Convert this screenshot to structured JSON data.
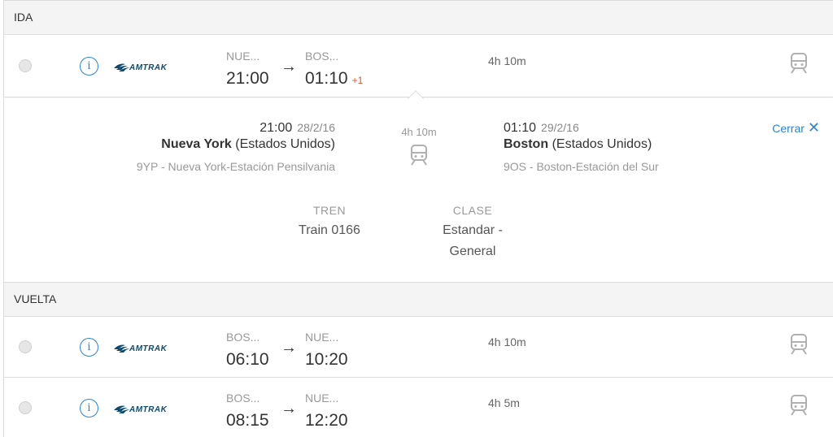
{
  "outbound": {
    "header": "IDA",
    "rows": [
      {
        "operator": "AMTRAK",
        "from_code": "NUE...",
        "to_code": "BOS...",
        "depart": "21:00",
        "arrive": "01:10",
        "day_offset": "+1",
        "duration": "4h 10m"
      }
    ],
    "detail": {
      "close_label": "Cerrar",
      "depart_time": "21:00",
      "depart_date": "28/2/16",
      "depart_city": "Nueva York",
      "depart_country": "(Estados Unidos)",
      "depart_station": "9YP - Nueva York-Estación Pensilvania",
      "duration": "4h 10m",
      "arrive_time": "01:10",
      "arrive_date": "29/2/16",
      "arrive_city": "Boston",
      "arrive_country": "(Estados Unidos)",
      "arrive_station": "9OS - Boston-Estación del Sur",
      "train_label": "TREN",
      "train_value": "Train 0166",
      "class_label": "CLASE",
      "class_value_1": "Estandar -",
      "class_value_2": "General"
    }
  },
  "return": {
    "header": "VUELTA",
    "rows": [
      {
        "operator": "AMTRAK",
        "from_code": "BOS...",
        "to_code": "NUE...",
        "depart": "06:10",
        "arrive": "10:20",
        "duration": "4h 10m"
      },
      {
        "operator": "AMTRAK",
        "from_code": "BOS...",
        "to_code": "NUE...",
        "depart": "08:15",
        "arrive": "12:20",
        "duration": "4h 5m"
      }
    ]
  },
  "colors": {
    "accent": "#2a84d6",
    "day_offset": "#e0562f",
    "logo": "#0d4a6f"
  },
  "icons": {
    "info": "info-icon",
    "train": "train-icon",
    "close": "close-icon",
    "arrow": "→"
  }
}
